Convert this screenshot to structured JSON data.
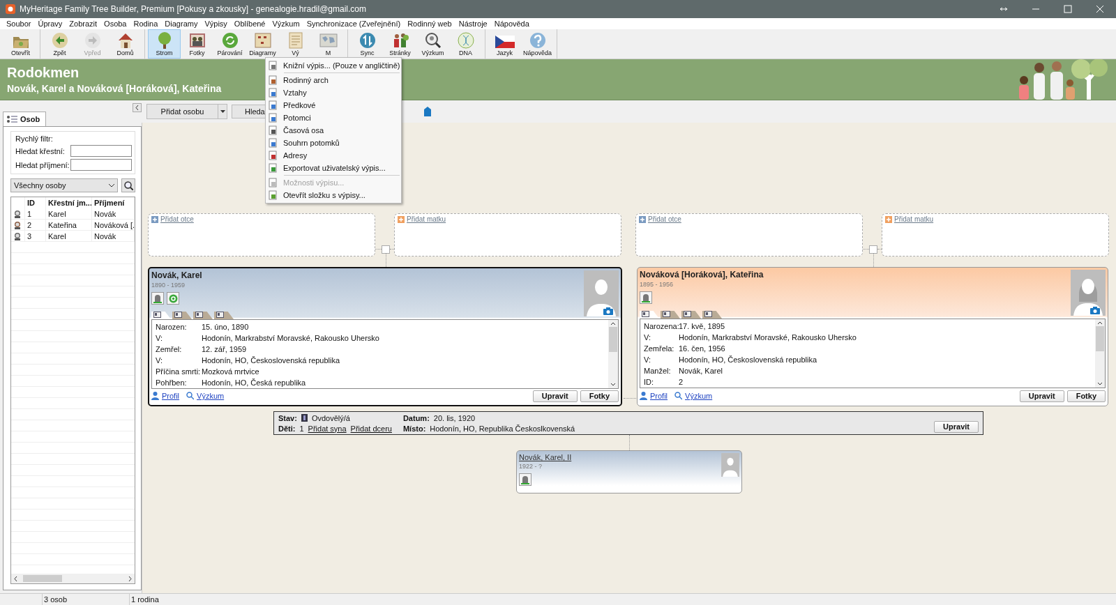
{
  "window": {
    "title": "MyHeritage Family Tree Builder, Premium [Pokusy a zkousky] - genealogie.hradil@gmail.com"
  },
  "menu_bar": [
    "Soubor",
    "Úpravy",
    "Zobrazit",
    "Osoba",
    "Rodina",
    "Diagramy",
    "Výpisy",
    "Oblíbené",
    "Výzkum",
    "Synchronizace (Zveřejnění)",
    "Rodinný web",
    "Nástroje",
    "Nápověda"
  ],
  "toolbar": [
    [
      {
        "label": "Otevřít",
        "kind": "folder",
        "selected": false,
        "disabled": false
      }
    ],
    [
      {
        "label": "Zpět",
        "kind": "back",
        "selected": false,
        "disabled": false
      },
      {
        "label": "Vpřed",
        "kind": "forward",
        "selected": false,
        "disabled": true
      },
      {
        "label": "Domů",
        "kind": "home",
        "selected": false,
        "disabled": false
      }
    ],
    [
      {
        "label": "Strom",
        "kind": "tree",
        "selected": true,
        "disabled": false
      },
      {
        "label": "Fotky",
        "kind": "photos",
        "selected": false,
        "disabled": false
      },
      {
        "label": "Párování",
        "kind": "match",
        "selected": false,
        "disabled": false
      },
      {
        "label": "Diagramy",
        "kind": "diagrams",
        "selected": false,
        "disabled": false
      },
      {
        "label": "Vý",
        "kind": "reports",
        "selected": false,
        "disabled": false
      },
      {
        "label": "M",
        "kind": "map",
        "selected": false,
        "disabled": false
      }
    ],
    [
      {
        "label": "Sync",
        "kind": "sync",
        "selected": false,
        "disabled": false
      },
      {
        "label": "Stránky",
        "kind": "pages",
        "selected": false,
        "disabled": false
      },
      {
        "label": "Výzkum",
        "kind": "research",
        "selected": false,
        "disabled": false
      },
      {
        "label": "DNA",
        "kind": "dna",
        "selected": false,
        "disabled": false
      }
    ],
    [
      {
        "label": "Jazyk",
        "kind": "flag",
        "selected": false,
        "disabled": false
      },
      {
        "label": "Nápověda",
        "kind": "help",
        "selected": false,
        "disabled": false
      }
    ]
  ],
  "header": {
    "title": "Rodokmen",
    "subtitle": "Novák, Karel a Nováková [Horáková], Kateřina"
  },
  "side_panel": {
    "tab": "Osob",
    "filter_title": "Rychlý filtr:",
    "fields": [
      {
        "label": "Hledat křestní:"
      },
      {
        "label": "Hledat příjmení:"
      }
    ],
    "dropdown": "Všechny osoby",
    "columns": [
      "ID",
      "Křestní jm...",
      "Příjmení"
    ],
    "rows": [
      {
        "kind": "male",
        "id": "1",
        "first": "Karel",
        "last": "Novák"
      },
      {
        "kind": "female",
        "id": "2",
        "first": "Kateřina",
        "last": "Nováková [."
      },
      {
        "kind": "male",
        "id": "3",
        "first": "Karel",
        "last": "Novák"
      }
    ]
  },
  "tree_toolbar": {
    "add_button": "Přidat osobu",
    "search_button": "Hleda"
  },
  "reports_menu": [
    [
      {
        "label": "Knižní výpis... (Pouze v angličtině)",
        "kind": "book",
        "disabled": false
      }
    ],
    [
      {
        "label": "Rodinný arch",
        "kind": "family",
        "disabled": false
      },
      {
        "label": "Vztahy",
        "kind": "relations",
        "disabled": false
      },
      {
        "label": "Předkové",
        "kind": "ancestors",
        "disabled": false
      },
      {
        "label": "Potomci",
        "kind": "descendants",
        "disabled": false
      },
      {
        "label": "Časová osa",
        "kind": "timeline",
        "disabled": false
      },
      {
        "label": "Souhrn potomků",
        "kind": "descendants",
        "disabled": false
      },
      {
        "label": "Adresy",
        "kind": "addresses",
        "disabled": false
      },
      {
        "label": "Exportovat uživatelský výpis...",
        "kind": "export",
        "disabled": false
      }
    ],
    [
      {
        "label": "Možnosti výpisu...",
        "kind": "options",
        "disabled": true
      },
      {
        "label": "Otevřít složku s výpisy...",
        "kind": "folder",
        "disabled": false
      }
    ]
  ],
  "persons": [
    {
      "name": "Novák, Karel",
      "years": "1890 - 1959",
      "kind": "male",
      "selected": true,
      "parents": [
        {
          "label": "Přidat otce",
          "kind": "father"
        },
        {
          "label": "Přidat matku",
          "kind": "mother"
        }
      ],
      "badges": [
        {
          "kind": "grave"
        },
        {
          "kind": "research"
        }
      ],
      "detail_tabs": [
        {
          "selected": true
        },
        {
          "selected": false
        },
        {
          "selected": false
        },
        {
          "selected": false
        }
      ],
      "details": [
        {
          "label": "Narozen:",
          "value": "15. úno, 1890"
        },
        {
          "label": "V:",
          "value": "Hodonín, Markrabství Moravské, Rakousko Uhersko"
        },
        {
          "label": "Zemřel:",
          "value": "12. zář, 1959"
        },
        {
          "label": "V:",
          "value": "Hodonín, HO, Československá republika"
        },
        {
          "label": "Příčina smrti:",
          "value": "Mozková mrtvice"
        },
        {
          "label": "Pohřben:",
          "value": "Hodonín, HO, Česká republika"
        }
      ],
      "links": [
        "Profil",
        "Výzkum"
      ],
      "buttons": [
        "Upravit",
        "Fotky"
      ]
    },
    {
      "name": "Nováková [Horáková], Kateřina",
      "years": "1895 - 1956",
      "kind": "female",
      "selected": false,
      "parents": [
        {
          "label": "Přidat otce",
          "kind": "father"
        },
        {
          "label": "Přidat matku",
          "kind": "mother"
        }
      ],
      "badges": [
        {
          "kind": "grave"
        }
      ],
      "detail_tabs": [
        {
          "selected": true
        },
        {
          "selected": false
        },
        {
          "selected": false
        },
        {
          "selected": false
        }
      ],
      "details": [
        {
          "label": "Narozena:",
          "value": "17. kvě, 1895"
        },
        {
          "label": "V:",
          "value": "Hodonín, Markrabství Moravské, Rakousko Uhersko"
        },
        {
          "label": "Zemřela:",
          "value": "16. čen, 1956"
        },
        {
          "label": "V:",
          "value": "Hodonín, HO, Československá republika"
        },
        {
          "label": "Manžel:",
          "value": "Novák, Karel"
        },
        {
          "label": "ID:",
          "value": "2"
        }
      ],
      "links": [
        "Profil",
        "Výzkum"
      ],
      "buttons": [
        "Upravit",
        "Fotky"
      ]
    }
  ],
  "family": {
    "status_label": "Stav:",
    "status": "Ovdovělý/á",
    "children_label": "Děti:",
    "children_count": "1",
    "add_son": "Přidat syna",
    "add_daughter": "Přidat dceru",
    "date_label": "Datum:",
    "date": "20. lis, 1920",
    "place_label": "Místo:",
    "place": "Hodonín, HO, Republika Českoslkovenská",
    "button": "Upravit"
  },
  "child": {
    "name": "Novák, Karel, II",
    "years": "1922 - ?",
    "badges": [
      {
        "kind": "grave"
      }
    ]
  },
  "status_bar": [
    "3 osob",
    "1 rodina"
  ]
}
